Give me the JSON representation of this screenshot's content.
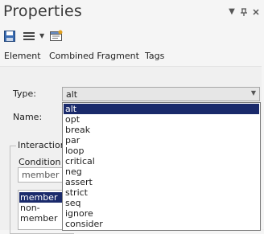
{
  "window": {
    "title": "Properties"
  },
  "title_controls": [
    "chevron-down-icon",
    "pin-icon",
    "close-icon"
  ],
  "toolbar": {
    "items": [
      "save-icon",
      "menu-icon",
      "properties-icon"
    ]
  },
  "tabs": [
    {
      "label": "Element"
    },
    {
      "label": "Combined Fragment"
    },
    {
      "label": "Tags"
    }
  ],
  "form": {
    "type_label": "Type:",
    "type_value": "alt",
    "name_label": "Name:",
    "group_label": "Interaction",
    "condition_label": "Condition",
    "condition_value": "member",
    "operands": [
      {
        "label": "member",
        "selected": true
      },
      {
        "label": "non-member",
        "selected": false
      }
    ]
  },
  "dropdown": {
    "options": [
      "alt",
      "opt",
      "break",
      "par",
      "loop",
      "critical",
      "neg",
      "assert",
      "strict",
      "seq",
      "ignore",
      "consider"
    ],
    "selected_index": 0
  },
  "colors": {
    "selection": "#1a2a6b",
    "background": "#f0f0f0"
  }
}
